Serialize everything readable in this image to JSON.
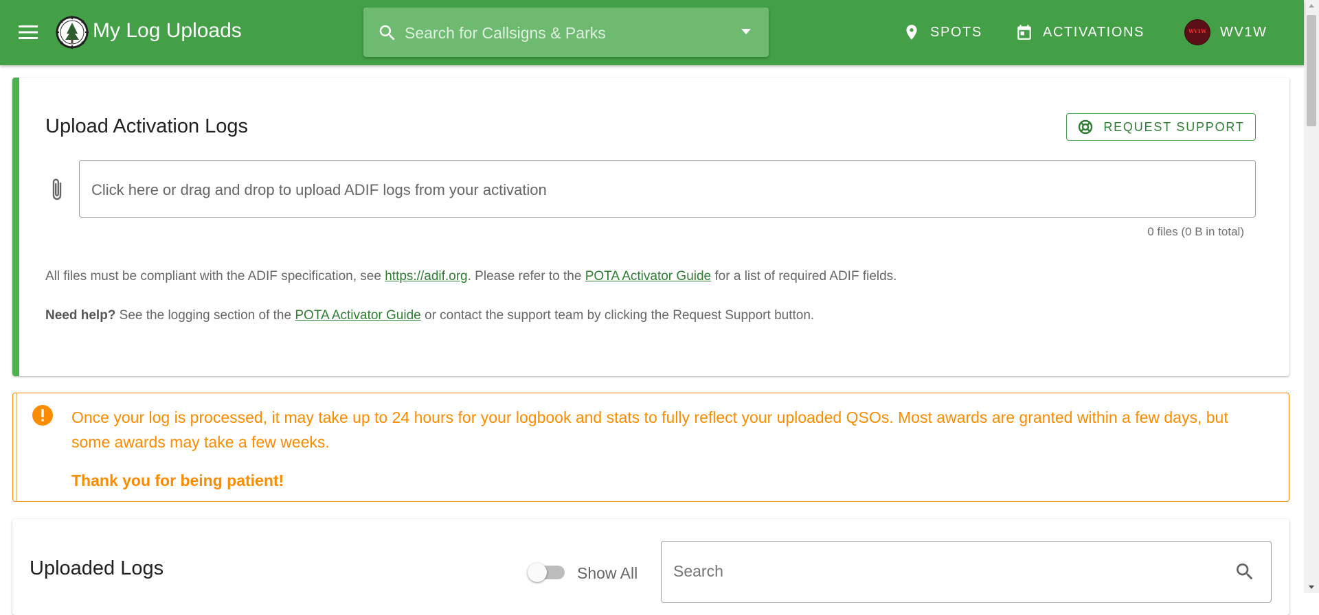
{
  "appbar": {
    "title": "My Log Uploads",
    "search_placeholder": "Search for Callsigns & Parks",
    "nav": {
      "spots": "SPOTS",
      "activations": "ACTIVATIONS",
      "user": "WV1W"
    },
    "avatar_text": "WV1W",
    "color": "#43a047"
  },
  "upload": {
    "title": "Upload Activation Logs",
    "support_button": "REQUEST SUPPORT",
    "file_input_placeholder": "Click here or drag and drop to upload ADIF logs from your activation",
    "file_count": "0 files (0 B in total)",
    "info1": {
      "pre": "All files must be compliant with the ADIF specification, see ",
      "link1": "https://adif.org",
      "mid": ". Please refer to the ",
      "link2": "POTA Activator Guide",
      "post": " for a list of required ADIF fields."
    },
    "info2": {
      "bold": "Need help?",
      "pre": " See the logging section of the ",
      "link": "POTA Activator Guide",
      "post": " or contact the support team by clicking the Request Support button."
    }
  },
  "alert": {
    "message": "Once your log is processed, it may take up to 24 hours for your logbook and stats to fully reflect your uploaded QSOs. Most awards are granted within a few days, but some awards may take a few weeks.",
    "strong": "Thank you for being patient!",
    "color": "#fb8c00"
  },
  "logs": {
    "title": "Uploaded Logs",
    "toggle_label": "Show All",
    "toggle_on": false,
    "search_placeholder": "Search"
  }
}
